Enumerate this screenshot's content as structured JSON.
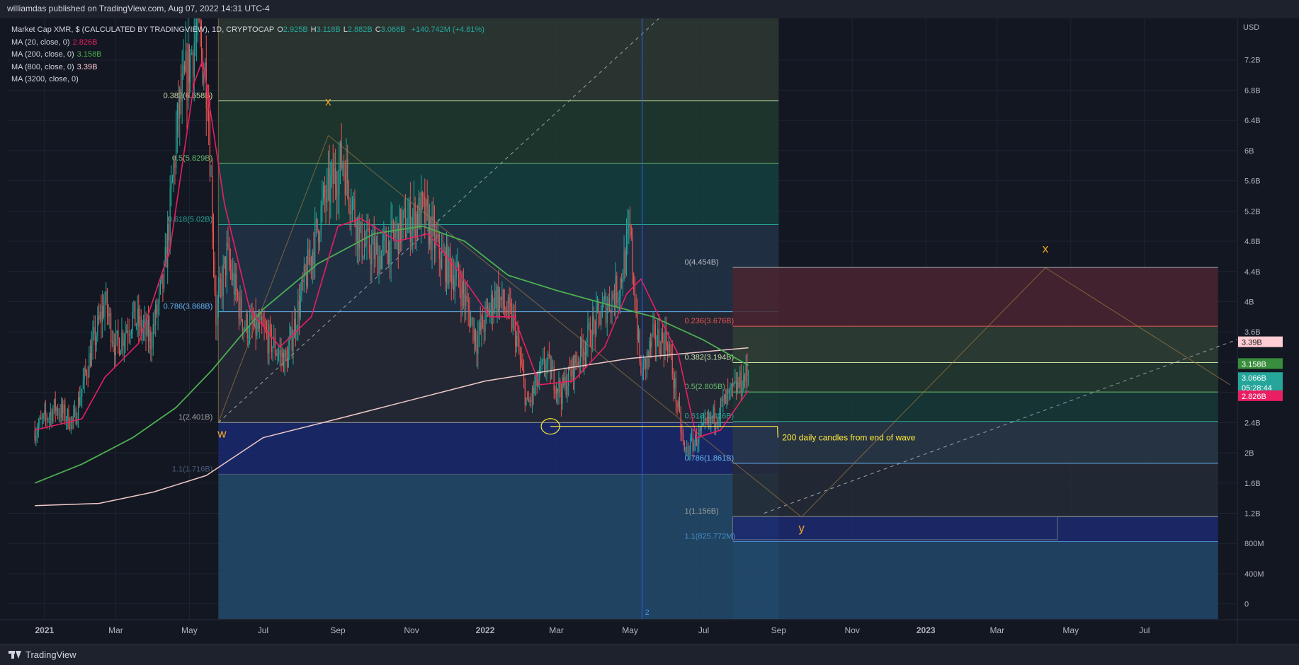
{
  "header": {
    "publish_line": "williamdas published on TradingView.com, Aug 07, 2022 14:31 UTC-4"
  },
  "legend": {
    "symbol": "Market Cap XMR, $ (CALCULATED BY TRADINGVIEW), 1D, CRYPTOCAP",
    "ohlc": [
      {
        "key": "O",
        "value": "2.925B"
      },
      {
        "key": "H",
        "value": "3.118B"
      },
      {
        "key": "L",
        "value": "2.882B"
      },
      {
        "key": "C",
        "value": "3.066B"
      }
    ],
    "change": "+140.742M (+4.81%)",
    "ma": [
      {
        "label": "MA (20, close, 0)",
        "value": "2.826B",
        "color": "#e91e63"
      },
      {
        "label": "MA (200, close, 0)",
        "value": "3.158B",
        "color": "#4caf50"
      },
      {
        "label": "MA (800, close, 0)",
        "value": "3.39B",
        "color": "#ffcdd2"
      },
      {
        "label": "MA (3200, close, 0)",
        "value": "",
        "color": "#787b86"
      }
    ]
  },
  "footer": {
    "brand": "TradingView"
  },
  "colors": {
    "background": "#131722",
    "up": "#26a69a",
    "down": "#ef5350",
    "ma20": "#e91e63",
    "ma200": "#4caf50",
    "ma800": "#f0c8c8",
    "vline": "#2962ff",
    "text_yellow": "#ffeb3b",
    "wave_orange": "#f5a623"
  },
  "chart_data": {
    "type": "candlestick",
    "x_dates": [
      "2021-01",
      "2021-03",
      "2021-05",
      "2021-07",
      "2021-09",
      "2021-11",
      "2022-01",
      "2022-03",
      "2022-05",
      "2022-07",
      "2022-09",
      "2022-11",
      "2023-01",
      "2023-03",
      "2023-05",
      "2023-07"
    ],
    "x_tick_labels": [
      "2021",
      "Mar",
      "May",
      "Jul",
      "Sep",
      "Nov",
      "2022",
      "Mar",
      "May",
      "Jul",
      "Sep",
      "Nov",
      "2023",
      "Mar",
      "May",
      "Jul"
    ],
    "y_axis_unit": "USD",
    "y_tick_values": [
      0,
      0.4,
      0.8,
      1.2,
      1.6,
      2.0,
      2.4,
      2.8,
      3.2,
      3.6,
      4.0,
      4.4,
      4.8,
      5.2,
      5.6,
      6.0,
      6.4,
      6.8,
      7.2
    ],
    "y_tick_labels": [
      "0",
      "400M",
      "800M",
      "1.2B",
      "1.6B",
      "2B",
      "2.4B",
      "",
      "",
      "3.6B",
      "4B",
      "4.4B",
      "4.8B",
      "5.2B",
      "5.6B",
      "6B",
      "6.4B",
      "6.8B",
      "7.2B"
    ],
    "y_range": [
      -0.2,
      7.75
    ],
    "price_path": [
      {
        "date": "2020-12-24",
        "value": 2.3
      },
      {
        "date": "2021-01-10",
        "value": 2.6
      },
      {
        "date": "2021-01-25",
        "value": 2.4
      },
      {
        "date": "2021-02-08",
        "value": 3.3
      },
      {
        "date": "2021-02-20",
        "value": 4.0
      },
      {
        "date": "2021-03-01",
        "value": 3.4
      },
      {
        "date": "2021-03-15",
        "value": 3.8
      },
      {
        "date": "2021-03-30",
        "value": 3.5
      },
      {
        "date": "2021-04-10",
        "value": 4.3
      },
      {
        "date": "2021-04-22",
        "value": 6.5
      },
      {
        "date": "2021-05-07",
        "value": 7.6
      },
      {
        "date": "2021-05-16",
        "value": 6.9
      },
      {
        "date": "2021-05-23",
        "value": 3.8
      },
      {
        "date": "2021-06-01",
        "value": 4.6
      },
      {
        "date": "2021-06-15",
        "value": 3.7
      },
      {
        "date": "2021-07-01",
        "value": 3.6
      },
      {
        "date": "2021-07-20",
        "value": 3.2
      },
      {
        "date": "2021-08-05",
        "value": 4.3
      },
      {
        "date": "2021-08-20",
        "value": 5.3
      },
      {
        "date": "2021-09-05",
        "value": 5.9
      },
      {
        "date": "2021-09-20",
        "value": 4.8
      },
      {
        "date": "2021-10-05",
        "value": 4.6
      },
      {
        "date": "2021-10-25",
        "value": 5.0
      },
      {
        "date": "2021-11-10",
        "value": 5.2
      },
      {
        "date": "2021-11-25",
        "value": 4.6
      },
      {
        "date": "2021-12-10",
        "value": 4.3
      },
      {
        "date": "2021-12-25",
        "value": 3.5
      },
      {
        "date": "2022-01-10",
        "value": 4.1
      },
      {
        "date": "2022-01-25",
        "value": 3.7
      },
      {
        "date": "2022-02-05",
        "value": 2.6
      },
      {
        "date": "2022-02-20",
        "value": 3.2
      },
      {
        "date": "2022-03-05",
        "value": 2.8
      },
      {
        "date": "2022-03-20",
        "value": 3.3
      },
      {
        "date": "2022-04-05",
        "value": 3.8
      },
      {
        "date": "2022-04-22",
        "value": 4.2
      },
      {
        "date": "2022-05-01",
        "value": 4.9
      },
      {
        "date": "2022-05-10",
        "value": 3.0
      },
      {
        "date": "2022-05-20",
        "value": 3.5
      },
      {
        "date": "2022-06-01",
        "value": 3.5
      },
      {
        "date": "2022-06-15",
        "value": 2.0
      },
      {
        "date": "2022-07-01",
        "value": 2.3
      },
      {
        "date": "2022-07-15",
        "value": 2.6
      },
      {
        "date": "2022-07-30",
        "value": 2.9
      },
      {
        "date": "2022-08-07",
        "value": 3.066
      }
    ],
    "ma20": [
      {
        "date": "2020-12-24",
        "value": 2.3
      },
      {
        "date": "2021-02-01",
        "value": 2.45
      },
      {
        "date": "2021-02-20",
        "value": 3.0
      },
      {
        "date": "2021-03-20",
        "value": 3.45
      },
      {
        "date": "2021-04-15",
        "value": 4.7
      },
      {
        "date": "2021-05-05",
        "value": 6.9
      },
      {
        "date": "2021-05-12",
        "value": 7.2
      },
      {
        "date": "2021-05-30",
        "value": 5.3
      },
      {
        "date": "2021-06-20",
        "value": 3.9
      },
      {
        "date": "2021-07-15",
        "value": 3.4
      },
      {
        "date": "2021-08-10",
        "value": 3.8
      },
      {
        "date": "2021-09-01",
        "value": 5.0
      },
      {
        "date": "2021-09-20",
        "value": 5.1
      },
      {
        "date": "2021-10-20",
        "value": 4.8
      },
      {
        "date": "2021-11-15",
        "value": 4.9
      },
      {
        "date": "2021-12-10",
        "value": 4.4
      },
      {
        "date": "2022-01-05",
        "value": 3.8
      },
      {
        "date": "2022-01-25",
        "value": 3.8
      },
      {
        "date": "2022-02-15",
        "value": 2.9
      },
      {
        "date": "2022-03-15",
        "value": 2.95
      },
      {
        "date": "2022-04-10",
        "value": 3.4
      },
      {
        "date": "2022-04-28",
        "value": 4.1
      },
      {
        "date": "2022-05-10",
        "value": 4.3
      },
      {
        "date": "2022-05-25",
        "value": 3.8
      },
      {
        "date": "2022-06-10",
        "value": 3.3
      },
      {
        "date": "2022-06-25",
        "value": 2.2
      },
      {
        "date": "2022-07-15",
        "value": 2.3
      },
      {
        "date": "2022-08-07",
        "value": 2.826
      }
    ],
    "ma200": [
      {
        "date": "2020-12-24",
        "value": 1.6
      },
      {
        "date": "2021-02-01",
        "value": 1.85
      },
      {
        "date": "2021-03-15",
        "value": 2.2
      },
      {
        "date": "2021-04-20",
        "value": 2.6
      },
      {
        "date": "2021-05-20",
        "value": 3.1
      },
      {
        "date": "2021-07-01",
        "value": 3.9
      },
      {
        "date": "2021-08-15",
        "value": 4.5
      },
      {
        "date": "2021-10-01",
        "value": 4.9
      },
      {
        "date": "2021-11-10",
        "value": 5.0
      },
      {
        "date": "2021-12-15",
        "value": 4.8
      },
      {
        "date": "2022-01-20",
        "value": 4.35
      },
      {
        "date": "2022-03-01",
        "value": 4.15
      },
      {
        "date": "2022-04-15",
        "value": 3.95
      },
      {
        "date": "2022-05-20",
        "value": 3.8
      },
      {
        "date": "2022-06-30",
        "value": 3.5
      },
      {
        "date": "2022-08-07",
        "value": 3.158
      }
    ],
    "ma800": [
      {
        "date": "2020-12-24",
        "value": 1.3
      },
      {
        "date": "2021-02-15",
        "value": 1.33
      },
      {
        "date": "2021-04-01",
        "value": 1.48
      },
      {
        "date": "2021-05-15",
        "value": 1.7
      },
      {
        "date": "2021-07-01",
        "value": 2.2
      },
      {
        "date": "2021-09-01",
        "value": 2.45
      },
      {
        "date": "2021-11-01",
        "value": 2.7
      },
      {
        "date": "2022-01-01",
        "value": 2.95
      },
      {
        "date": "2022-03-01",
        "value": 3.1
      },
      {
        "date": "2022-05-01",
        "value": 3.25
      },
      {
        "date": "2022-08-07",
        "value": 3.39
      }
    ],
    "fib_1": {
      "range": [
        "2021-05-25",
        "2022-09-01"
      ],
      "levels": [
        {
          "label": "0.382(6.658B)",
          "value": 6.658
        },
        {
          "label": "0.5(5.829B)",
          "value": 5.829
        },
        {
          "label": "0.618(5.02B)",
          "value": 5.02
        },
        {
          "label": "0.786(3.868B)",
          "value": 3.868
        },
        {
          "label": "1(2.401B)",
          "value": 2.401
        },
        {
          "label": "1.1(1.716B)",
          "value": 1.716
        }
      ]
    },
    "fib_2": {
      "range": [
        "2022-07-25",
        "2023-08-31"
      ],
      "levels": [
        {
          "label": "0(4.454B)",
          "value": 4.454
        },
        {
          "label": "0.236(3.676B)",
          "value": 3.676
        },
        {
          "label": "0.382(3.194B)",
          "value": 3.194
        },
        {
          "label": "0.5(2.805B)",
          "value": 2.805
        },
        {
          "label": "0.618(2.416B)",
          "value": 2.416
        },
        {
          "label": "0.786(1.861B)",
          "value": 1.861
        },
        {
          "label": "1(1.156B)",
          "value": 1.156
        },
        {
          "label": "1.1(825.772M)",
          "value": 0.825772
        }
      ]
    },
    "wave_labels": [
      {
        "label": "w",
        "date": "2021-05-28",
        "value": 2.2
      },
      {
        "label": "x",
        "date": "2021-08-24",
        "value": 6.6
      },
      {
        "label": "x",
        "date": "2023-04-10",
        "value": 4.65
      },
      {
        "label": "y",
        "date": "2022-09-20",
        "value": 0.95
      }
    ],
    "annotation": {
      "text": "200 daily candles from end of wave",
      "date": "2022-09-04",
      "value": 2.2
    },
    "vertical_marker": {
      "date": "2022-05-11",
      "label": "2"
    },
    "price_labels": [
      {
        "text": "3.39B",
        "value": 3.39,
        "bg": "#ffcdd2",
        "fg": "#131722"
      },
      {
        "text": "3.158B",
        "value": 3.158,
        "bg": "#388e3c",
        "fg": "#ffffff"
      },
      {
        "text": "3.066B",
        "value": 3.066,
        "bg": "#26a69a",
        "fg": "#ffffff",
        "sub": "05:28:44"
      },
      {
        "text": "2.826B",
        "value": 2.826,
        "bg": "#e91e63",
        "fg": "#ffffff"
      }
    ]
  }
}
